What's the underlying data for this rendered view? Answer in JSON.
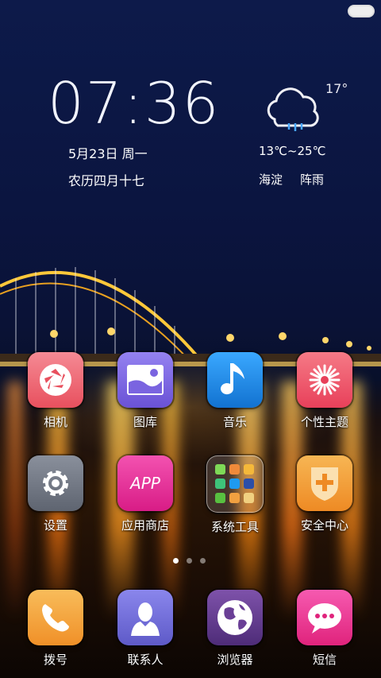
{
  "clock": {
    "time": "07:36",
    "date": "5月23日  周一",
    "lunar": "农历四月十七"
  },
  "weather": {
    "current_temp": "17°",
    "range": "13℃~25℃",
    "location": "海淀",
    "condition": "阵雨",
    "icon": "cloud-moon-rain-icon"
  },
  "apps_row1": [
    {
      "label": "相机",
      "icon": "camera-aperture-icon",
      "color": "#f06a78"
    },
    {
      "label": "图库",
      "icon": "gallery-icon",
      "color": "#7a64e0"
    },
    {
      "label": "音乐",
      "icon": "music-note-icon",
      "color": "#1e8ce8"
    },
    {
      "label": "个性主题",
      "icon": "theme-flower-icon",
      "color": "#f05a6e"
    }
  ],
  "apps_row2": [
    {
      "label": "设置",
      "icon": "gear-icon",
      "color": "#6e7480"
    },
    {
      "label": "应用商店",
      "icon": "app-store-icon",
      "color": "#e8339a"
    },
    {
      "label": "系统工具",
      "icon": "folder-icon",
      "color": "#556070"
    },
    {
      "label": "安全中心",
      "icon": "shield-plus-icon",
      "color": "#f5a23a"
    }
  ],
  "app_store_text": "APP",
  "dock": [
    {
      "label": "拨号",
      "icon": "phone-icon",
      "color": "#f5a33a"
    },
    {
      "label": "联系人",
      "icon": "contact-icon",
      "color": "#6e6ad8"
    },
    {
      "label": "浏览器",
      "icon": "globe-icon",
      "color": "#6a3f96"
    },
    {
      "label": "短信",
      "icon": "message-icon",
      "color": "#f03d94"
    }
  ],
  "page_indicator": {
    "count": 3,
    "active": 1
  }
}
